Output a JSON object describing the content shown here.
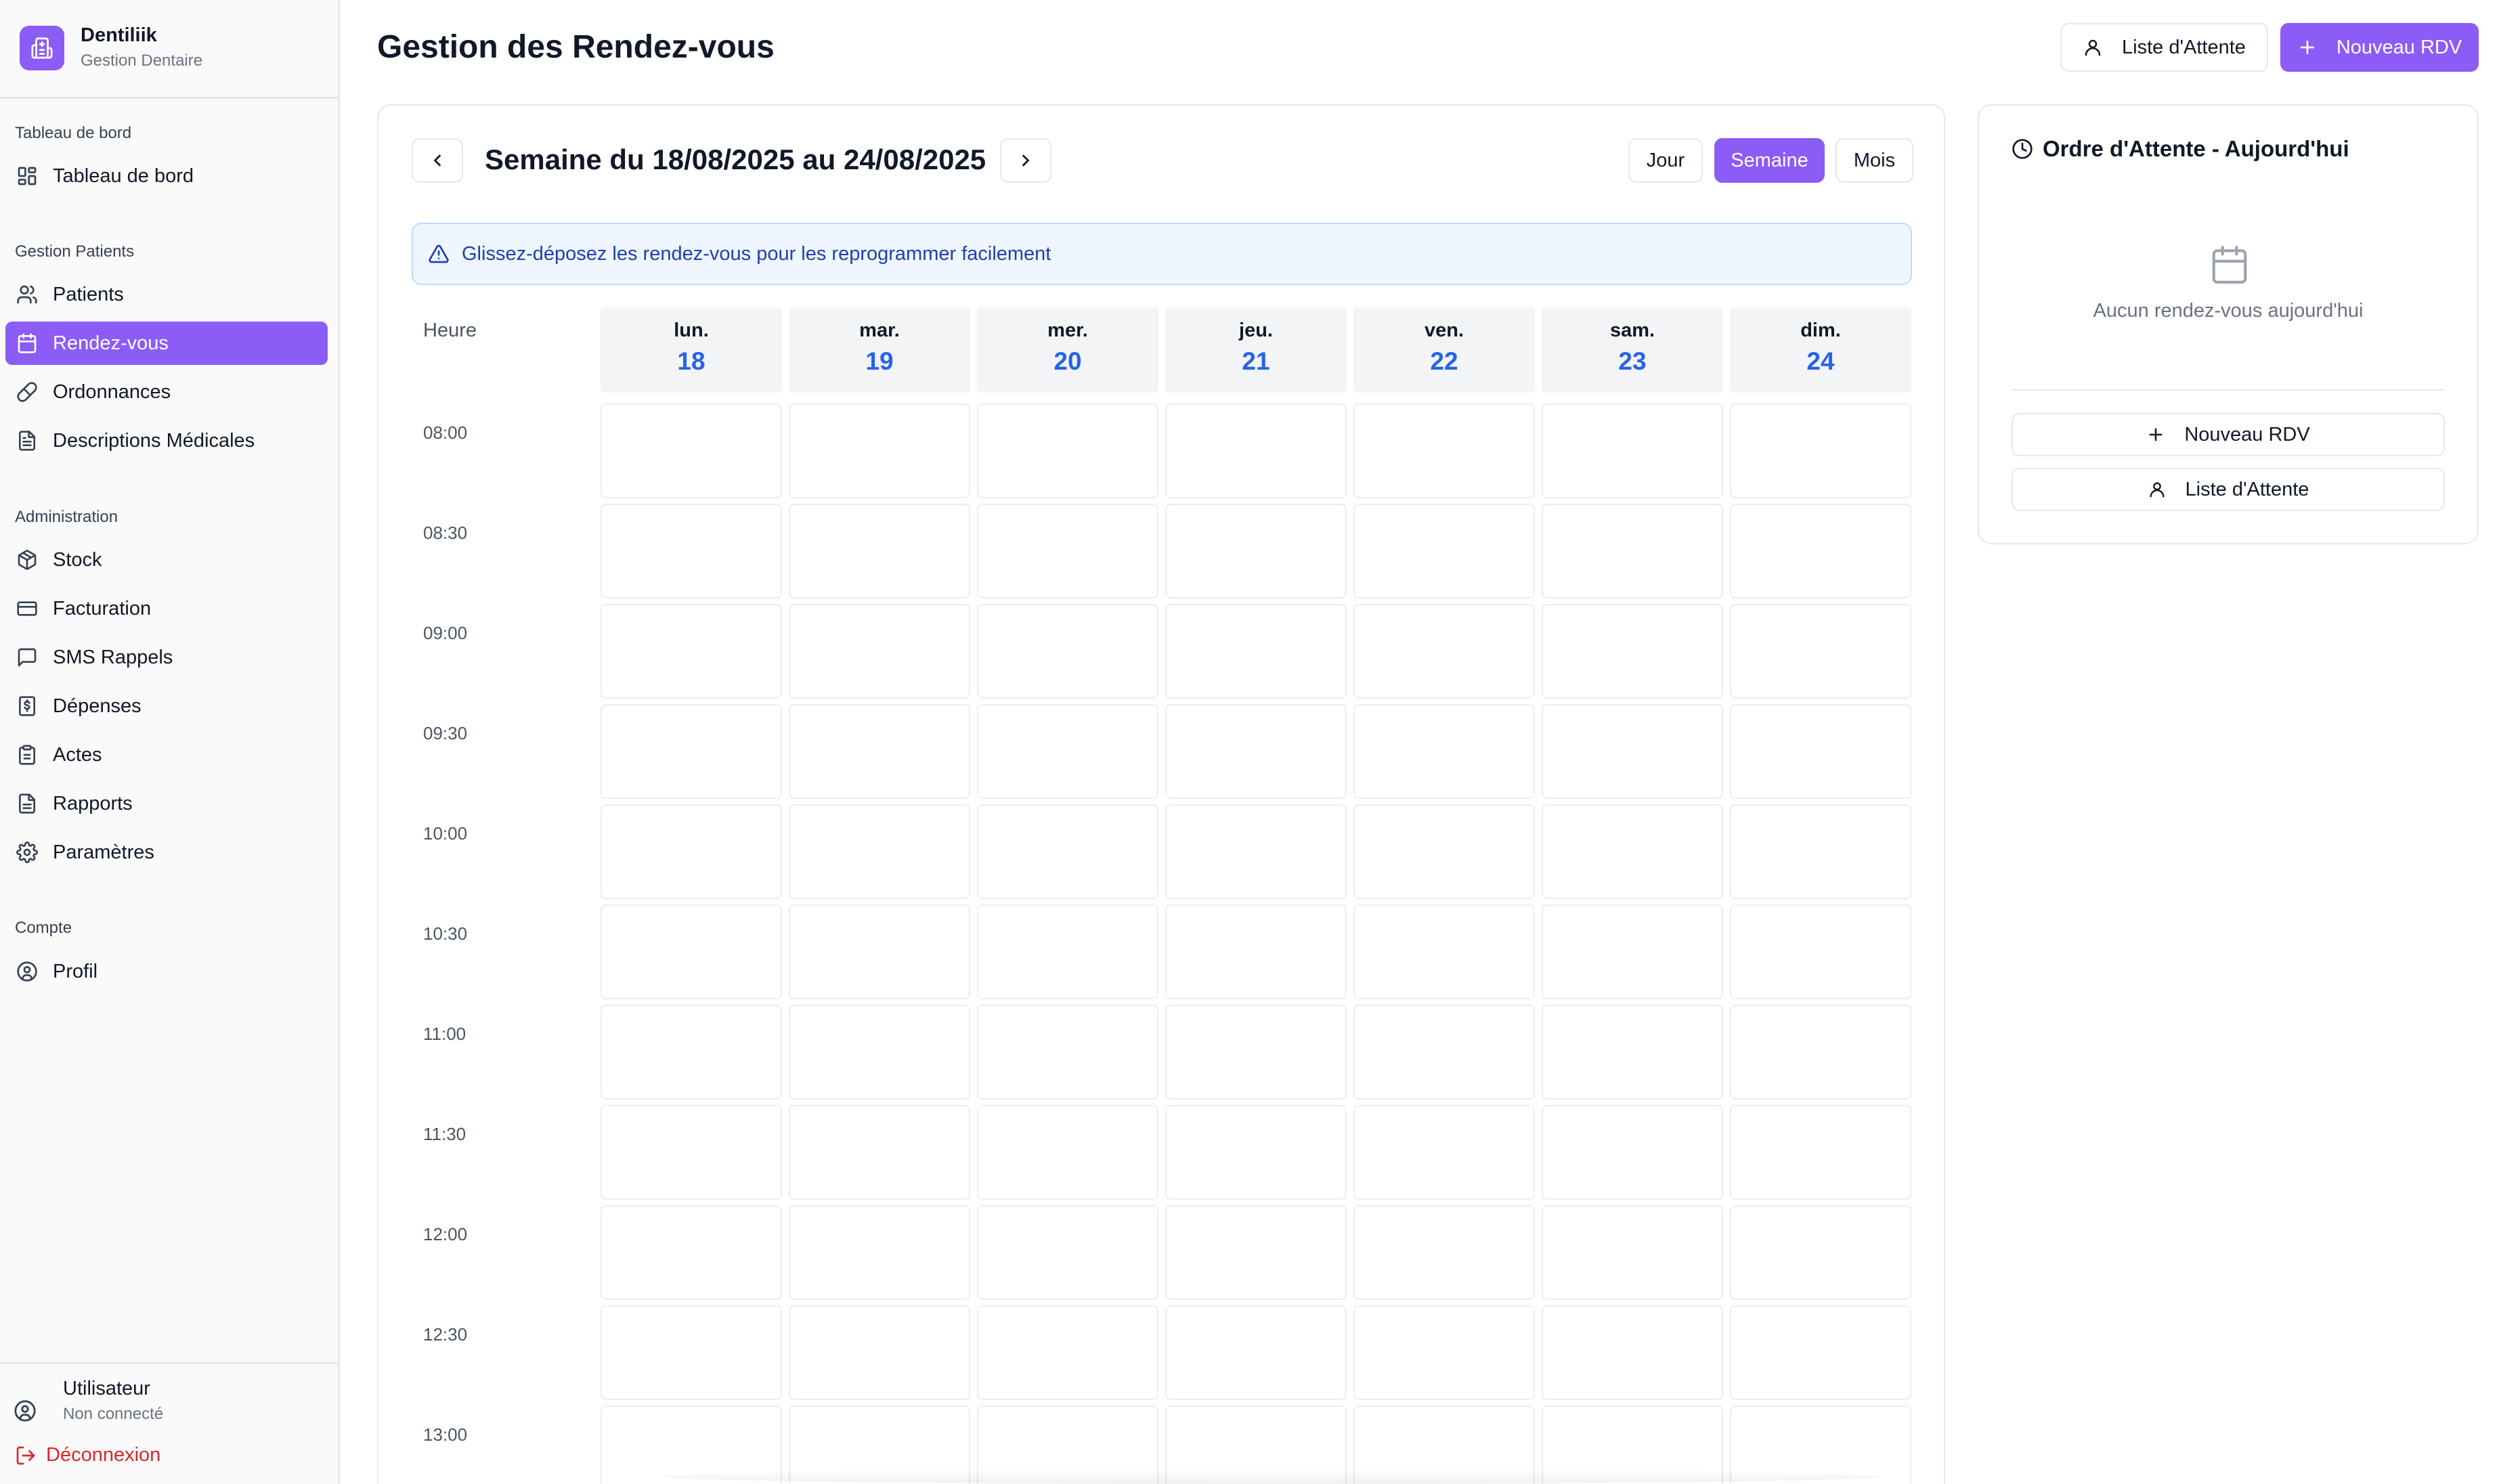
{
  "brand": {
    "name": "Dentiliik",
    "subtitle": "Gestion Dentaire"
  },
  "sidebar": {
    "sections": [
      {
        "label": "Tableau de bord",
        "items": [
          {
            "label": "Tableau de bord",
            "icon": "dashboard-icon"
          }
        ]
      },
      {
        "label": "Gestion Patients",
        "items": [
          {
            "label": "Patients",
            "icon": "users-icon"
          },
          {
            "label": "Rendez-vous",
            "icon": "calendar-icon",
            "active": true
          },
          {
            "label": "Ordonnances",
            "icon": "pill-icon"
          },
          {
            "label": "Descriptions Médicales",
            "icon": "file-text-icon"
          }
        ]
      },
      {
        "label": "Administration",
        "items": [
          {
            "label": "Stock",
            "icon": "package-icon"
          },
          {
            "label": "Facturation",
            "icon": "credit-card-icon"
          },
          {
            "label": "SMS Rappels",
            "icon": "message-icon"
          },
          {
            "label": "Dépenses",
            "icon": "receipt-dollar-icon"
          },
          {
            "label": "Actes",
            "icon": "clipboard-icon"
          },
          {
            "label": "Rapports",
            "icon": "report-icon"
          },
          {
            "label": "Paramètres",
            "icon": "gear-icon"
          }
        ]
      },
      {
        "label": "Compte",
        "items": [
          {
            "label": "Profil",
            "icon": "user-circle-icon"
          }
        ]
      }
    ],
    "user": {
      "name": "Utilisateur",
      "status": "Non connecté"
    },
    "logout_label": "Déconnexion"
  },
  "header": {
    "title": "Gestion des Rendez-vous",
    "waitlist_button": "Liste d'Attente",
    "new_appointment_button": "Nouveau RDV"
  },
  "calendar": {
    "week_title": "Semaine du 18/08/2025 au 24/08/2025",
    "views": {
      "day": "Jour",
      "week": "Semaine",
      "month": "Mois",
      "active": "week"
    },
    "alert": "Glissez-déposez les rendez-vous pour les reprogrammer facilement",
    "hour_header": "Heure",
    "days": [
      {
        "name": "lun.",
        "num": "18"
      },
      {
        "name": "mar.",
        "num": "19"
      },
      {
        "name": "mer.",
        "num": "20"
      },
      {
        "name": "jeu.",
        "num": "21"
      },
      {
        "name": "ven.",
        "num": "22"
      },
      {
        "name": "sam.",
        "num": "23"
      },
      {
        "name": "dim.",
        "num": "24"
      }
    ],
    "times": [
      "08:00",
      "08:30",
      "09:00",
      "09:30",
      "10:00",
      "10:30",
      "11:00",
      "11:30",
      "12:00",
      "12:30",
      "13:00"
    ]
  },
  "waitlist": {
    "title": "Ordre d'Attente - Aujourd'hui",
    "empty_text": "Aucun rendez-vous aujourd'hui",
    "new_button": "Nouveau RDV",
    "list_button": "Liste d'Attente"
  },
  "colors": {
    "accent": "#8b5cf6",
    "day_number": "#2563eb",
    "alert_bg": "#eff6ff",
    "alert_text": "#1e40af",
    "logout": "#dc2626"
  }
}
